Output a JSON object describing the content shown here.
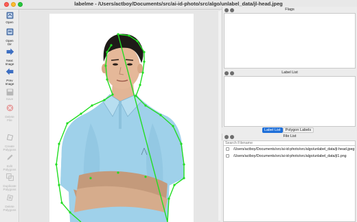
{
  "window": {
    "title": "labelme - /Users/actboy/Documents/src/ai-id-photo/src/algo/unlabel_data/jl-head.jpeg"
  },
  "toolbar": {
    "items": [
      {
        "label": "Open",
        "icon": "folder-open-icon",
        "enabled": true
      },
      {
        "label": "Open Dir",
        "icon": "folder-icon",
        "enabled": true
      },
      {
        "label": "Next Image",
        "icon": "arrow-right-icon",
        "enabled": true
      },
      {
        "label": "Prev Image",
        "icon": "arrow-left-icon",
        "enabled": true
      },
      {
        "label": "Save",
        "icon": "save-icon",
        "enabled": false
      },
      {
        "label": "Delete File",
        "icon": "delete-icon",
        "enabled": false
      },
      {
        "label": "Create Polygons",
        "icon": "create-polygon-icon",
        "enabled": false
      },
      {
        "label": "Edit Polygons",
        "icon": "edit-polygon-icon",
        "enabled": false
      },
      {
        "label": "Duplicate Polygons",
        "icon": "duplicate-polygon-icon",
        "enabled": false
      },
      {
        "label": "Delete Polygons",
        "icon": "delete-polygon-icon",
        "enabled": false
      }
    ]
  },
  "docks": {
    "flags": {
      "title": "Flags"
    },
    "label_list": {
      "title": "Label List"
    },
    "file_list": {
      "title": "File List"
    }
  },
  "tabs": {
    "label_list": "Label List",
    "polygon_labels": "Polygon Labels"
  },
  "file_list": {
    "search_placeholder": "Search Filename",
    "files": [
      {
        "name": "/Users/actboy/Documents/src/ai-id-photo/src/algo/unlabel_data/jl-head.jpeg",
        "checked": false
      },
      {
        "name": "/Users/actboy/Documents/src/ai-id-photo/src/algo/unlabel_data/jl1.png",
        "checked": false
      }
    ]
  },
  "colors": {
    "polygon": "#22dd22",
    "accent": "#1e6fd9",
    "shirt": "#9fd1ea"
  }
}
